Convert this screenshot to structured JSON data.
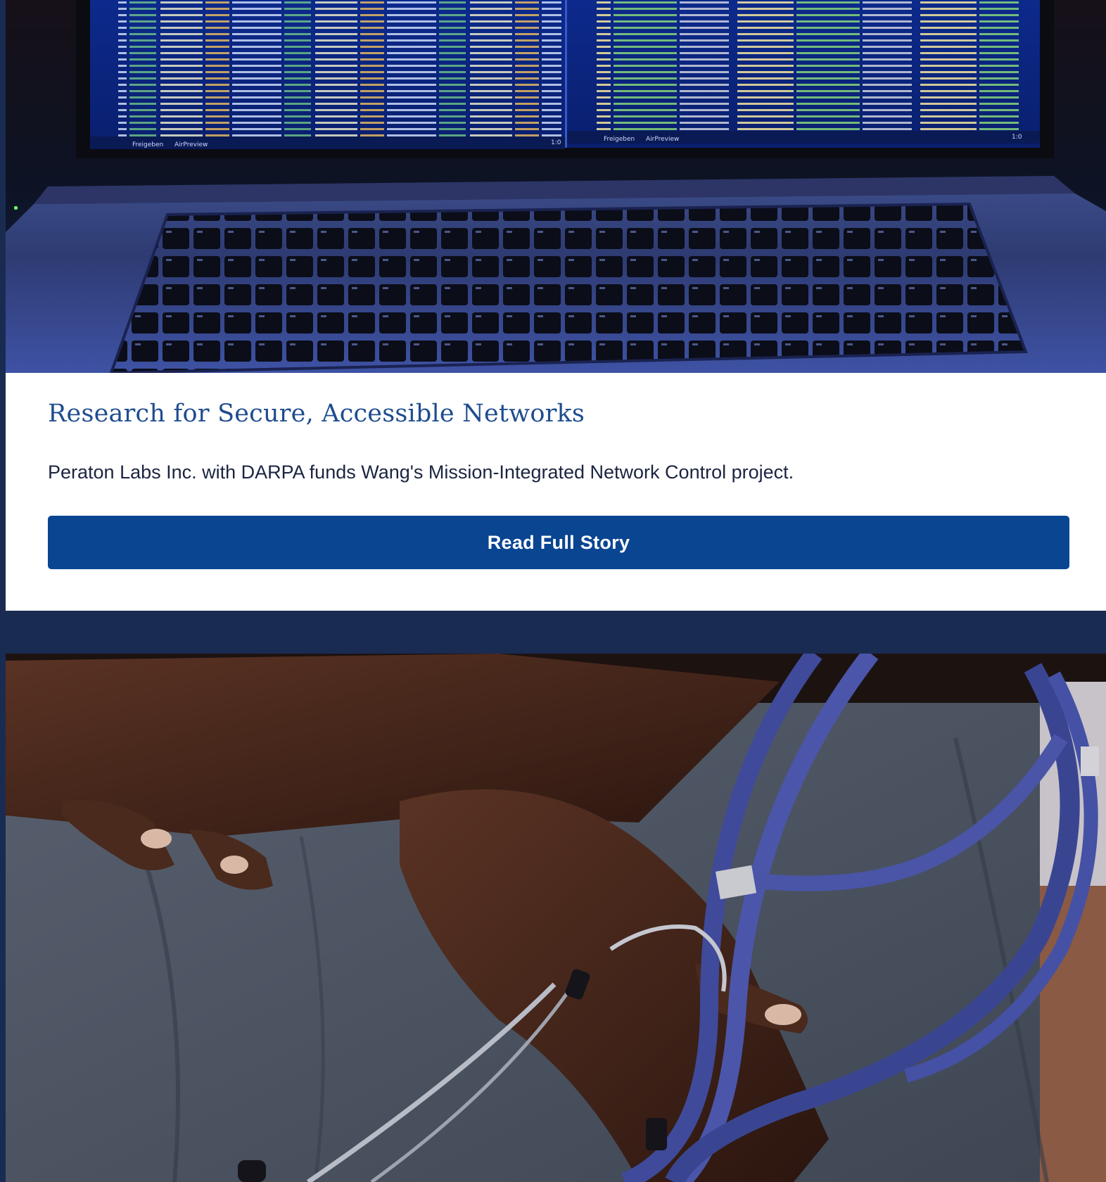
{
  "stories": [
    {
      "image": {
        "icon": "laptop-code-photo",
        "left_editor_status": [
          "Freigeben",
          "AirPreview"
        ],
        "right_editor_status": [
          "Freigeben",
          "AirPreview"
        ],
        "left_position": "1:0",
        "right_position": "1:0"
      },
      "title": "Research for Secure, Accessible Networks",
      "description": "Peraton Labs Inc. with DARPA funds Wang's Mission-Integrated Network Control project.",
      "button_label": "Read Full Story"
    },
    {
      "image": {
        "icon": "stethoscope-hands-photo"
      }
    }
  ],
  "colors": {
    "page_background": "#1a2b52",
    "title": "#1e4c8f",
    "button": "#0a4592",
    "button_text": "#ffffff",
    "body_text": "#1b2540"
  }
}
